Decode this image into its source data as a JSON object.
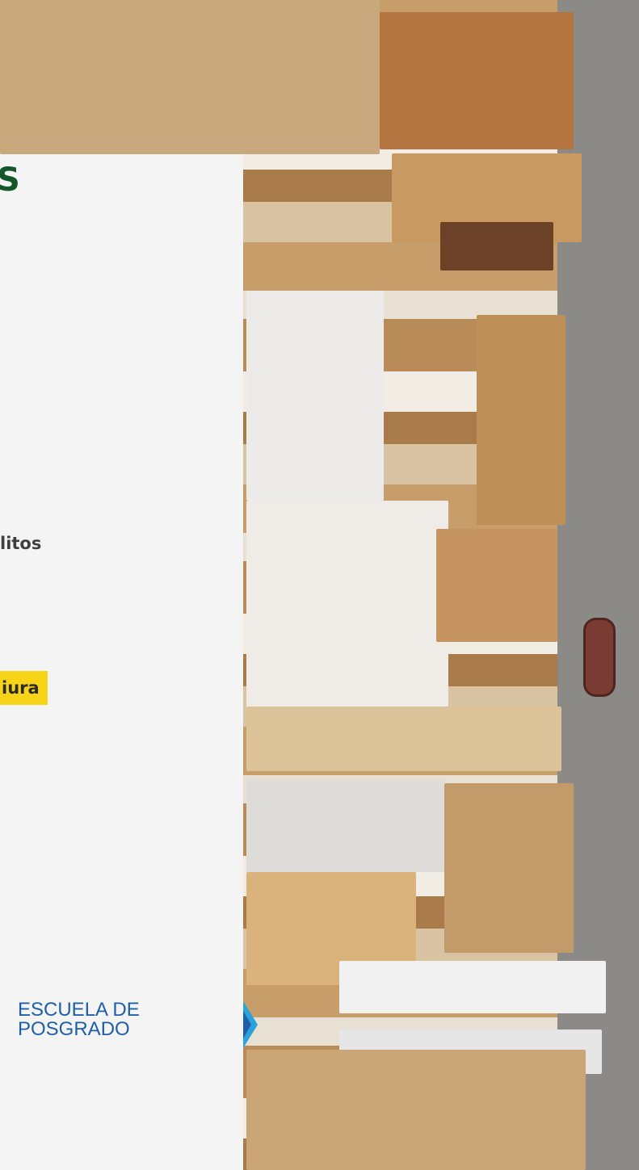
{
  "panel": {
    "heading_fragment": "S",
    "credits_fragment": "litos",
    "location_badge": "iura"
  },
  "logo": {
    "line1": "ESCUELA DE",
    "line2": "POSGRADO",
    "mark_icon": "school-logo-mark",
    "color": "#1f5fa8"
  },
  "colors": {
    "heading": "#13572b",
    "badge_bg": "#f7d417",
    "panel_bg": "#f4f4f4"
  }
}
